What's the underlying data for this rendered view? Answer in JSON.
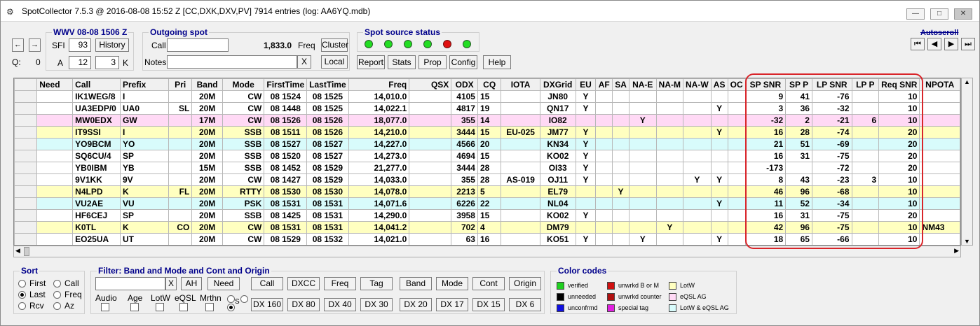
{
  "window": {
    "title": "SpotCollector 7.5.3 @ 2016-08-08  15:52 Z [CC,DXK,DXV,PV] 7914 entries (log: AA6YQ.mdb)"
  },
  "wwv": {
    "title": "WWV 08-08 1506 Z",
    "sfi_label": "SFI",
    "sfi": "93",
    "history_label": "History",
    "a_label": "A",
    "a": "12",
    "k_value": "3",
    "k_label": "K"
  },
  "nav": {
    "q_label": "Q:",
    "q_value": "0"
  },
  "outgoing": {
    "title": "Outgoing spot",
    "call_label": "Call",
    "freq_value": "1,833.0",
    "freq_label": "Freq",
    "cluster_label": "Cluster",
    "notes_label": "Notes",
    "clear_label": "X",
    "local_label": "Local"
  },
  "spot_source": {
    "title": "Spot source status",
    "leds": [
      "green",
      "green",
      "green",
      "green",
      "red",
      "green"
    ]
  },
  "toolbar": {
    "report": "Report",
    "stats": "Stats",
    "prop": "Prop",
    "config": "Config",
    "help": "Help"
  },
  "autoscroll": {
    "label": "Autoscroll"
  },
  "table": {
    "columns": [
      "Need",
      "Call",
      "Prefix",
      "Pri",
      "Band",
      "Mode",
      "FirstTime",
      "LastTime",
      "Freq",
      "QSX",
      "ODX",
      "CQ",
      "IOTA",
      "DXGrid",
      "EU",
      "AF",
      "SA",
      "NA-E",
      "NA-M",
      "NA-W",
      "AS",
      "OC",
      "SP SNR",
      "SP P",
      "LP SNR",
      "LP P",
      "Req SNR",
      "NPOTA"
    ],
    "rows": [
      {
        "bg": "#ffffff",
        "cells": [
          "",
          "IK1WEG/8",
          "I",
          "",
          "20M",
          "CW",
          "08 1524",
          "08 1525",
          "14,010.0",
          "",
          "4105",
          "15",
          "",
          "JN80",
          "Y",
          "",
          "",
          "",
          "",
          "",
          "",
          "",
          "9",
          "41",
          "-76",
          "",
          "10",
          ""
        ]
      },
      {
        "bg": "#ffffff",
        "cells": [
          "",
          "UA3EDP/0",
          "UA0",
          "SL",
          "20M",
          "CW",
          "08 1448",
          "08 1525",
          "14,022.1",
          "",
          "4817",
          "19",
          "",
          "QN17",
          "Y",
          "",
          "",
          "",
          "",
          "",
          "Y",
          "",
          "3",
          "36",
          "-32",
          "",
          "10",
          ""
        ]
      },
      {
        "bg": "#ffd9f5",
        "cells": [
          "",
          "MW0EDX",
          "GW",
          "",
          "17M",
          "CW",
          "08 1526",
          "08 1526",
          "18,077.0",
          "",
          "355",
          "14",
          "",
          "IO82",
          "",
          "",
          "",
          "Y",
          "",
          "",
          "",
          "",
          "-32",
          "2",
          "-21",
          "6",
          "10",
          ""
        ]
      },
      {
        "bg": "#ffffc0",
        "cells": [
          "",
          "IT9SSI",
          "I",
          "",
          "20M",
          "SSB",
          "08 1511",
          "08 1526",
          "14,210.0",
          "",
          "3444",
          "15",
          "EU-025",
          "JM77",
          "Y",
          "",
          "",
          "",
          "",
          "",
          "Y",
          "",
          "16",
          "28",
          "-74",
          "",
          "20",
          ""
        ]
      },
      {
        "bg": "#d8fbfb",
        "cells": [
          "",
          "YO9BCM",
          "YO",
          "",
          "20M",
          "SSB",
          "08 1527",
          "08 1527",
          "14,227.0",
          "",
          "4566",
          "20",
          "",
          "KN34",
          "Y",
          "",
          "",
          "",
          "",
          "",
          "",
          "",
          "21",
          "51",
          "-69",
          "",
          "20",
          ""
        ]
      },
      {
        "bg": "#ffffff",
        "cells": [
          "",
          "SQ6CU/4",
          "SP",
          "",
          "20M",
          "SSB",
          "08 1520",
          "08 1527",
          "14,273.0",
          "",
          "4694",
          "15",
          "",
          "KO02",
          "Y",
          "",
          "",
          "",
          "",
          "",
          "",
          "",
          "16",
          "31",
          "-75",
          "",
          "20",
          ""
        ]
      },
      {
        "bg": "#ffffff",
        "cells": [
          "",
          "YB0IBM",
          "YB",
          "",
          "15M",
          "SSB",
          "08 1452",
          "08 1529",
          "21,277.0",
          "",
          "3444",
          "28",
          "",
          "OI33",
          "Y",
          "",
          "",
          "",
          "",
          "",
          "",
          "",
          "-173",
          "",
          "-72",
          "",
          "20",
          ""
        ]
      },
      {
        "bg": "#ffffff",
        "cells": [
          "",
          "9V1KK",
          "9V",
          "",
          "20M",
          "CW",
          "08 1427",
          "08 1529",
          "14,033.0",
          "",
          "355",
          "28",
          "AS-019",
          "OJ11",
          "Y",
          "",
          "",
          "",
          "",
          "Y",
          "Y",
          "",
          "8",
          "43",
          "-23",
          "3",
          "10",
          ""
        ]
      },
      {
        "bg": "#ffffc0",
        "cells": [
          "",
          "N4LPD",
          "K",
          "FL",
          "20M",
          "RTTY",
          "08 1530",
          "08 1530",
          "14,078.0",
          "",
          "2213",
          "5",
          "",
          "EL79",
          "",
          "",
          "Y",
          "",
          "",
          "",
          "",
          "",
          "46",
          "96",
          "-68",
          "",
          "10",
          ""
        ]
      },
      {
        "bg": "#d8fbfb",
        "cells": [
          "",
          "VU2AE",
          "VU",
          "",
          "20M",
          "PSK",
          "08 1531",
          "08 1531",
          "14,071.6",
          "",
          "6226",
          "22",
          "",
          "NL04",
          "",
          "",
          "",
          "",
          "",
          "",
          "Y",
          "",
          "11",
          "52",
          "-34",
          "",
          "10",
          ""
        ]
      },
      {
        "bg": "#ffffff",
        "cells": [
          "",
          "HF6CEJ",
          "SP",
          "",
          "20M",
          "SSB",
          "08 1425",
          "08 1531",
          "14,290.0",
          "",
          "3958",
          "15",
          "",
          "KO02",
          "Y",
          "",
          "",
          "",
          "",
          "",
          "",
          "",
          "16",
          "31",
          "-75",
          "",
          "20",
          ""
        ]
      },
      {
        "bg": "#ffffc0",
        "cells": [
          "",
          "K0TL",
          "K",
          "CO",
          "20M",
          "CW",
          "08 1531",
          "08 1531",
          "14,041.2",
          "",
          "702",
          "4",
          "",
          "DM79",
          "",
          "",
          "",
          "",
          "Y",
          "",
          "",
          "",
          "42",
          "96",
          "-75",
          "",
          "10",
          "NM43"
        ]
      },
      {
        "bg": "#ffffff",
        "cells": [
          "",
          "EO25UA",
          "UT",
          "",
          "20M",
          "CW",
          "08 1529",
          "08 1532",
          "14,021.0",
          "",
          "63",
          "16",
          "",
          "KO51",
          "Y",
          "",
          "",
          "Y",
          "",
          "",
          "Y",
          "",
          "18",
          "65",
          "-66",
          "",
          "10",
          ""
        ]
      }
    ]
  },
  "sort": {
    "title": "Sort",
    "options": [
      {
        "label": "First",
        "selected": false
      },
      {
        "label": "Call",
        "selected": false
      },
      {
        "label": "Last",
        "selected": true
      },
      {
        "label": "Freq",
        "selected": false
      },
      {
        "label": "Rcv",
        "selected": false
      },
      {
        "label": "Az",
        "selected": false
      }
    ]
  },
  "filter": {
    "title": "Filter: Band and Mode and Cont and Origin",
    "clear_label": "X",
    "ah_label": "AH",
    "need_label": "Need",
    "buttons_row1": [
      "Call",
      "DXCC",
      "Freq",
      "Tag",
      "Band",
      "Mode",
      "Cont",
      "Origin"
    ],
    "check_labels": [
      "Audio",
      "Age",
      "LotW",
      "eQSL",
      "Mrthn"
    ],
    "s_label": "S",
    "buttons_row2": [
      "DX 160",
      "DX 80",
      "DX 40",
      "DX 30",
      "DX 20",
      "DX 17",
      "DX 15",
      "DX 6"
    ]
  },
  "color_codes": {
    "title": "Color codes",
    "items": [
      {
        "label": "verified",
        "color": "#20d020"
      },
      {
        "label": "unneeded",
        "color": "#000000"
      },
      {
        "label": "unconfrmd",
        "color": "#1010e0"
      },
      {
        "label": "unwrkd B or M",
        "color": "#d01010"
      },
      {
        "label": "unwrkd counter",
        "color": "#b01010"
      },
      {
        "label": "special tag",
        "color": "#e020e0"
      },
      {
        "label": "LotW",
        "color": "#ffffc0"
      },
      {
        "label": "eQSL AG",
        "color": "#ffd9f5"
      },
      {
        "label": "LotW & eQSL AG",
        "color": "#d8fbfb"
      }
    ]
  }
}
